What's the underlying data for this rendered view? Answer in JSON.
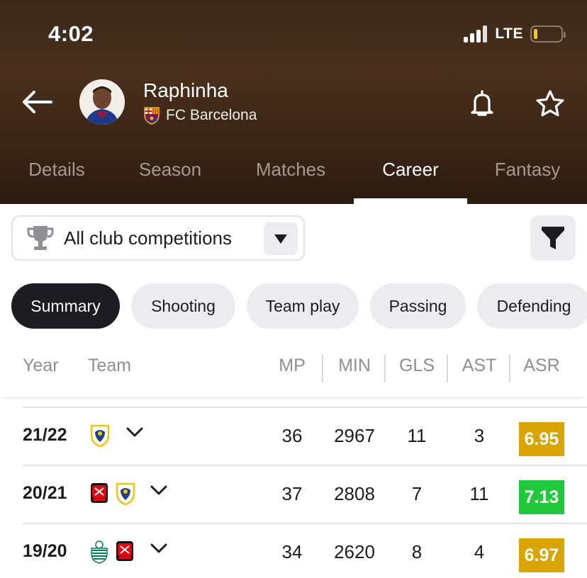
{
  "status_bar": {
    "time": "4:02",
    "network": "LTE"
  },
  "player": {
    "name": "Raphinha",
    "club": "FC Barcelona"
  },
  "tabs": [
    {
      "label": "Details",
      "active": false
    },
    {
      "label": "Season",
      "active": false
    },
    {
      "label": "Matches",
      "active": false
    },
    {
      "label": "Career",
      "active": true
    },
    {
      "label": "Fantasy",
      "active": false
    }
  ],
  "competition_select": {
    "label": "All club competitions"
  },
  "chips": [
    {
      "label": "Summary",
      "active": true
    },
    {
      "label": "Shooting",
      "active": false
    },
    {
      "label": "Team play",
      "active": false
    },
    {
      "label": "Passing",
      "active": false
    },
    {
      "label": "Defending",
      "active": false
    }
  ],
  "table": {
    "headers": {
      "year": "Year",
      "team": "Team",
      "mp": "MP",
      "min": "MIN",
      "gls": "GLS",
      "ast": "AST",
      "asr": "ASR"
    },
    "rows": [
      {
        "year": "21/22",
        "teams": [
          "leeds-united-icon"
        ],
        "mp": "36",
        "min": "2967",
        "gls": "11",
        "ast": "3",
        "asr": "6.95",
        "asr_color": "#d9a300"
      },
      {
        "year": "20/21",
        "teams": [
          "stade-rennais-icon",
          "leeds-united-icon"
        ],
        "mp": "37",
        "min": "2808",
        "gls": "7",
        "ast": "11",
        "asr": "7.13",
        "asr_color": "#1fc93a"
      },
      {
        "year": "19/20",
        "teams": [
          "sporting-cp-icon",
          "stade-rennais-icon"
        ],
        "mp": "34",
        "min": "2620",
        "gls": "8",
        "ast": "4",
        "asr": "6.97",
        "asr_color": "#d9a300"
      }
    ]
  },
  "colors": {
    "header_bg": "#3b2818",
    "active_chip": "#1c1c22",
    "rating_mid": "#d9a300",
    "rating_good": "#1fc93a"
  }
}
